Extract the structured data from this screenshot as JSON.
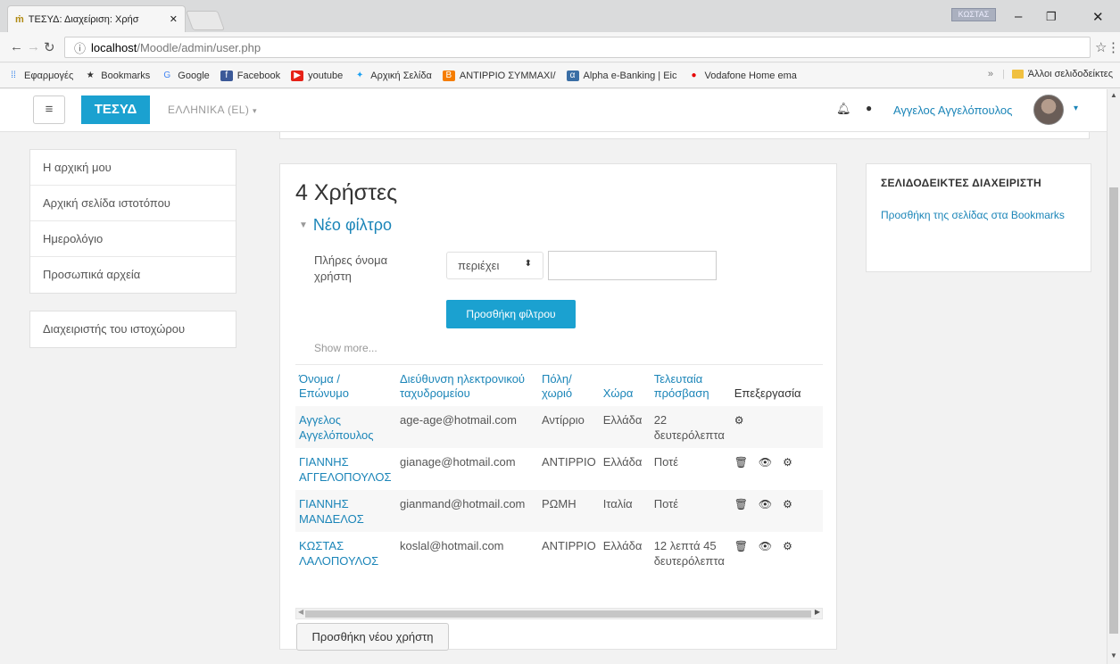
{
  "browser": {
    "tab_title": "ΤΕΣΥΔ: Διαχείριση: Χρήσ",
    "tab_icon": "moodle-icon",
    "profile_chip": "ΚΩΣΤΑΣ",
    "url_host": "localhost",
    "url_path": "/Moodle/admin/user.php",
    "bookmarks": [
      {
        "label": "Εφαρμογές",
        "icon": "apps-icon",
        "color": "#1a73e8"
      },
      {
        "label": "Bookmarks",
        "icon": "star-icon",
        "color": "#333333"
      },
      {
        "label": "Google",
        "icon": "google-icon",
        "color": "#4285f4"
      },
      {
        "label": "Facebook",
        "icon": "facebook-icon",
        "color": "#3b5998"
      },
      {
        "label": "youtube",
        "icon": "youtube-icon",
        "color": "#e62117"
      },
      {
        "label": "Αρχική Σελίδα",
        "icon": "twitter-icon",
        "color": "#1da1f2"
      },
      {
        "label": "ΑΝΤΙΡΡΙΟ ΣΥΜΜΑΧΙ/",
        "icon": "blogger-icon",
        "color": "#f57d00"
      },
      {
        "label": "Alpha e-Banking | Eic",
        "icon": "bank-icon",
        "color": "#3a6ea5"
      },
      {
        "label": "Vodafone Home ema",
        "icon": "vodafone-icon",
        "color": "#e60000"
      }
    ],
    "more_bookmarks": "»",
    "other_bookmarks": "Άλλοι σελιδοδείκτες"
  },
  "navbar": {
    "brand": "ΤΕΣΥΔ",
    "language": "ΕΛΛΗΝΙΚΑ (EL)",
    "user_name": "Αγγελος Αγγελόπουλος"
  },
  "left_nav": {
    "items": [
      "Η αρχική μου",
      "Αρχική σελίδα ιστοτόπου",
      "Ημερολόγιο",
      "Προσωπικά αρχεία"
    ],
    "admin_item": "Διαχειριστής του ιστοχώρου"
  },
  "main": {
    "heading": "4 Χρήστες",
    "filter_title": "Νέο φίλτρο",
    "filter_label": "Πλήρες όνομα χρήστη",
    "filter_operator": "περιέχει",
    "filter_value": "",
    "add_filter_button": "Προσθήκη φίλτρου",
    "show_more": "Show more...",
    "table": {
      "headers": [
        "Όνομα / Επώνυμο",
        "Διεύθυνση ηλεκτρονικού ταχυδρομείου",
        "Πόλη/ χωριό",
        "Χώρα",
        "Τελευταία πρόσβαση",
        "Επεξεργασία"
      ],
      "rows": [
        {
          "name": "Αγγελος Αγγελόπουλος",
          "email": "age-age@hotmail.com",
          "city": "Αντίρριο",
          "country": "Ελλάδα",
          "last_access": "22 δευτερόλεπτα",
          "actions": [
            "settings-icon"
          ]
        },
        {
          "name": "ΓΙΑΝΝΗΣ ΑΓΓΕΛΟΠΟΥΛΟΣ",
          "email": "gianage@hotmail.com",
          "city": "ΑΝΤΙΡΡΙΟ",
          "country": "Ελλάδα",
          "last_access": "Ποτέ",
          "actions": [
            "delete-icon",
            "eye-icon",
            "settings-icon"
          ]
        },
        {
          "name": "ΓΙΑΝΝΗΣ ΜΑΝΔΕΛΟΣ",
          "email": "gianmand@hotmail.com",
          "city": "ΡΩΜΗ",
          "country": "Ιταλία",
          "last_access": "Ποτέ",
          "actions": [
            "delete-icon",
            "eye-icon",
            "settings-icon"
          ]
        },
        {
          "name": "ΚΩΣΤΑΣ ΛΑΛΟΠΟΥΛΟΣ",
          "email": "koslal@hotmail.com",
          "city": "ΑΝΤΙΡΡΙΟ",
          "country": "Ελλάδα",
          "last_access": "12 λεπτά 45 δευτερόλεπτα",
          "actions": [
            "delete-icon",
            "eye-icon",
            "settings-icon"
          ]
        }
      ]
    },
    "add_user_button": "Προσθήκη νέου χρήστη"
  },
  "right_block": {
    "title": "ΣΕΛΙΔΟΔΕΙΚΤΕΣ ΔΙΑΧΕΙΡΙΣΤΗ",
    "link": "Προσθήκη της σελίδας στα Bookmarks"
  },
  "colors": {
    "accent": "#1ba1d0",
    "link": "#1b85b8"
  }
}
